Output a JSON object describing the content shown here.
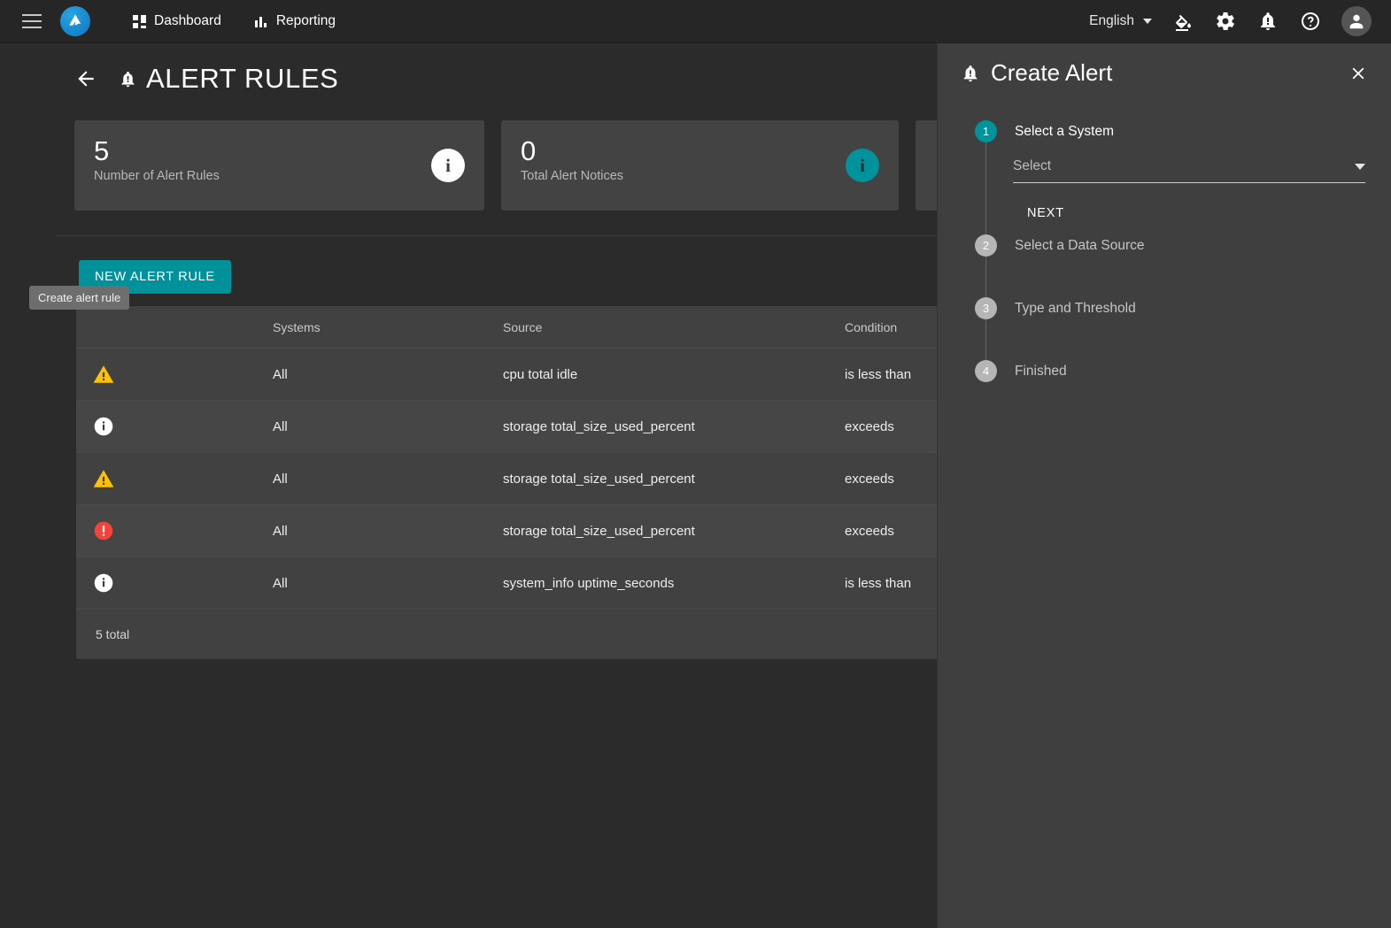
{
  "topbar": {
    "menu_icon": "hamburger-menu-icon",
    "logo_icon": "app-logo-icon",
    "nav": [
      {
        "label": "Dashboard",
        "icon": "dashboard-grid-icon"
      },
      {
        "label": "Reporting",
        "icon": "bar-chart-icon"
      }
    ],
    "language": "English",
    "icons": [
      {
        "name": "format-color-fill-icon"
      },
      {
        "name": "gear-icon"
      },
      {
        "name": "alert-bell-icon"
      },
      {
        "name": "help-circle-icon"
      },
      {
        "name": "account-avatar-icon"
      }
    ]
  },
  "page": {
    "back_icon": "back-arrow-icon",
    "title_icon": "bell-alert-icon",
    "title": "ALERT RULES",
    "cards": [
      {
        "value": "5",
        "label": "Number of Alert Rules",
        "badge": "i",
        "badge_style": "white"
      },
      {
        "value": "0",
        "label": "Total Alert Notices",
        "badge": "i",
        "badge_style": "teal"
      },
      {
        "value": "",
        "label": "",
        "badge": "",
        "badge_style": "white"
      }
    ],
    "new_rule_button": "NEW ALERT RULE",
    "tooltip": "Create alert rule",
    "table": {
      "columns": [
        "",
        "Systems",
        "Source",
        "Condition"
      ],
      "rows": [
        {
          "severity": "warning-triangle-icon",
          "systems": "All",
          "source": "cpu total idle",
          "condition": "is less than"
        },
        {
          "severity": "info-circle-icon",
          "systems": "All",
          "source": "storage total_size_used_percent",
          "condition": "exceeds"
        },
        {
          "severity": "warning-triangle-icon",
          "systems": "All",
          "source": "storage total_size_used_percent",
          "condition": "exceeds"
        },
        {
          "severity": "critical-circle-icon",
          "systems": "All",
          "source": "storage total_size_used_percent",
          "condition": "exceeds"
        },
        {
          "severity": "info-circle-icon",
          "systems": "All",
          "source": "system_info uptime_seconds",
          "condition": "is less than"
        }
      ],
      "footer": "5 total"
    }
  },
  "panel": {
    "icon": "bell-alert-icon",
    "title": "Create Alert",
    "close_icon": "close-icon",
    "steps": [
      {
        "num": "1",
        "label": "Select a System",
        "state": "active"
      },
      {
        "num": "2",
        "label": "Select a Data Source",
        "state": "idle"
      },
      {
        "num": "3",
        "label": "Type and Threshold",
        "state": "idle"
      },
      {
        "num": "4",
        "label": "Finished",
        "state": "idle"
      }
    ],
    "system_select": {
      "value": "Select",
      "placeholder": "Select"
    },
    "next_button": "NEXT"
  },
  "colors": {
    "accent_teal": "#00939c",
    "warning_yellow": "#ffc107",
    "critical_red": "#f4433a",
    "info_white": "#ffffff",
    "page_bg": "#2b2b2b",
    "panel_bg": "#3f3f3f",
    "card_bg": "#434343"
  }
}
